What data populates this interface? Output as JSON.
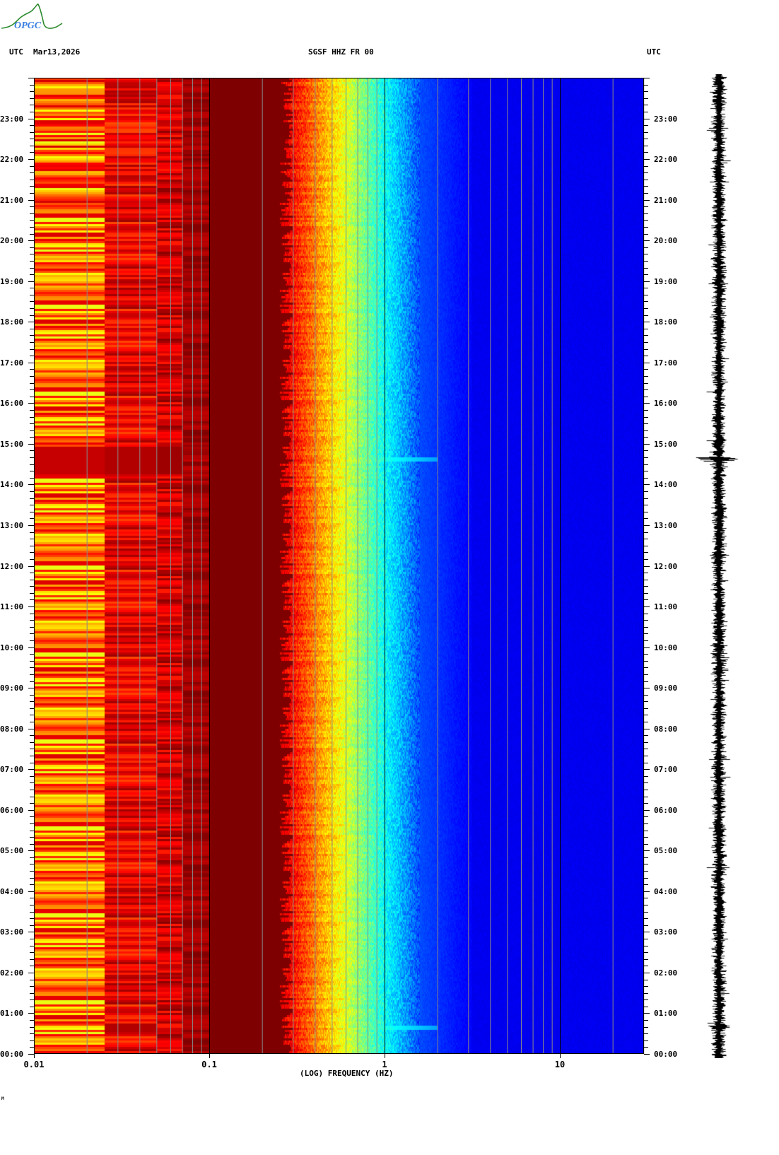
{
  "header": {
    "logo_text": "OPGC",
    "left_tz": "UTC",
    "date": "Mar13,2026",
    "station": "SGSF HHZ FR 00",
    "right_tz": "UTC"
  },
  "footer_mark": "M",
  "colors": {
    "low": "#00007f",
    "high": "#7f0000",
    "logo_green": "#2e8b2e",
    "logo_blue": "#3a7fe0"
  },
  "chart_data": {
    "type": "heatmap",
    "title": "SGSF HHZ FR 00",
    "subtitle": "Mar13,2026",
    "xlabel": "(LOG) FREQUENCY (HZ)",
    "ylabel": "UTC",
    "x_scale": "log",
    "xlim": [
      0.01,
      30
    ],
    "ylim_hours": [
      0,
      24
    ],
    "x_ticks": [
      {
        "value": 0.01,
        "label": "0.01"
      },
      {
        "value": 0.1,
        "label": "0.1"
      },
      {
        "value": 1,
        "label": "1"
      },
      {
        "value": 10,
        "label": "10"
      }
    ],
    "y_ticks": [
      "00:00",
      "01:00",
      "02:00",
      "03:00",
      "04:00",
      "05:00",
      "06:00",
      "07:00",
      "08:00",
      "09:00",
      "10:00",
      "11:00",
      "12:00",
      "13:00",
      "14:00",
      "15:00",
      "16:00",
      "17:00",
      "18:00",
      "19:00",
      "20:00",
      "21:00",
      "22:00",
      "23:00"
    ],
    "colormap": "jet",
    "grid": true,
    "events_utc_hours": [
      0.67,
      14.63
    ]
  }
}
